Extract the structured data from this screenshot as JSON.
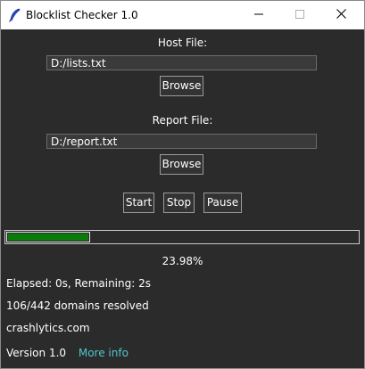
{
  "window": {
    "title": "Blocklist Checker 1.0"
  },
  "host": {
    "label": "Host File:",
    "value": "D:/lists.txt",
    "browse_label": "Browse"
  },
  "report": {
    "label": "Report File:",
    "value": "D:/report.txt",
    "browse_label": "Browse"
  },
  "controls": {
    "start_label": "Start",
    "stop_label": "Stop",
    "pause_label": "Pause"
  },
  "progress": {
    "fraction": 0.2398,
    "percent_text": "23.98%",
    "fill_color": "#0a7a0a"
  },
  "status": {
    "elapsed_text": "Elapsed: 0s, Remaining: 2s",
    "resolved_text": "106/442 domains resolved",
    "domain_text": "crashlytics.com"
  },
  "footer": {
    "version_text": "Version 1.0",
    "more_info_label": "More info",
    "link_color": "#4fc6ce"
  },
  "icons": {
    "app": "feather-icon",
    "minimize": "minimize-icon",
    "maximize": "maximize-icon",
    "close": "close-icon"
  }
}
